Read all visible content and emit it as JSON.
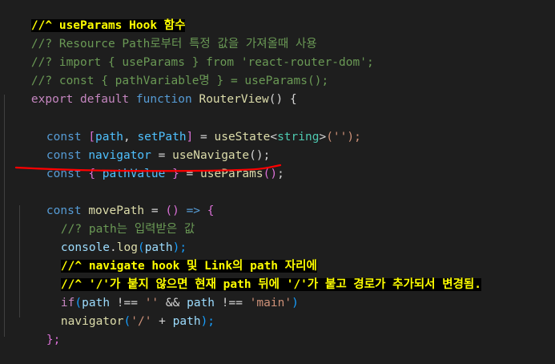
{
  "colors": {
    "background": "#1e1e1e",
    "keyword": "#569cd6",
    "control_keyword": "#c586c0",
    "variable": "#9cdcfe",
    "constant": "#4fc1ff",
    "function": "#dcdcaa",
    "type": "#4ec9b0",
    "string": "#ce9178",
    "comment": "#6a9955",
    "highlight_bg": "#000000",
    "highlight_fg": "#ffff00",
    "annotation_underline": "#ff0000"
  },
  "code": {
    "l1": {
      "text": "//^ useParams Hook 함수"
    },
    "l2": {
      "text": "//? Resource Path로부터 특정 값을 가져올때 사용"
    },
    "l3": {
      "text": "//? import { useParams } from 'react-router-dom';"
    },
    "l4": {
      "text": "//? const { pathVariable명 } = useParams();"
    },
    "l5": {
      "export": "export",
      "default": "default",
      "function": "function",
      "name": "RouterView",
      "rest": "() {"
    },
    "l7": {
      "const": "const",
      "open": "[",
      "a": "path",
      "comma": ", ",
      "b": "setPath",
      "close": "]",
      "eq": " = ",
      "fn": "useState",
      "lt": "<",
      "type": "string",
      "gt": ">",
      "args": "('');"
    },
    "l8": {
      "const": "const",
      "name": "navigator",
      "eq": " = ",
      "fn": "useNavigate",
      "rest": "();"
    },
    "l9": {
      "const": "const",
      "open": "{",
      "name": "pathValue",
      "close": "}",
      "eq": " = ",
      "fn": "useParams",
      "paren": "()",
      "semi": ";"
    },
    "l11": {
      "const": "const",
      "name": "movePath",
      "eq": " = ",
      "args": "() ",
      "arrow": "=>",
      "brace": " {"
    },
    "l12": {
      "text": "//? path는 입력받은 값"
    },
    "l13": {
      "obj": "console",
      "dot": ".",
      "fn": "log",
      "open": "(",
      "arg": "path",
      "close": ");"
    },
    "l14": {
      "text": "//^ navigate hook 및 Link의 path 자리에"
    },
    "l15": {
      "text": "//^ '/'가 붙지 않으면 현재 path 뒤에 '/'가 붙고 경로가 추가되서 변경됨."
    },
    "l16": {
      "if": "if",
      "open": "(",
      "a": "path",
      "op1": " !== ",
      "s1": "''",
      "and": " && ",
      "b": "path",
      "op2": " !== ",
      "s2": "'main'",
      "close": ")"
    },
    "l17": {
      "obj": "navigator",
      "open": "(",
      "s": "'/'",
      "plus": " + ",
      "arg": "path",
      "close": ");"
    },
    "l18": {
      "text": "};"
    }
  }
}
